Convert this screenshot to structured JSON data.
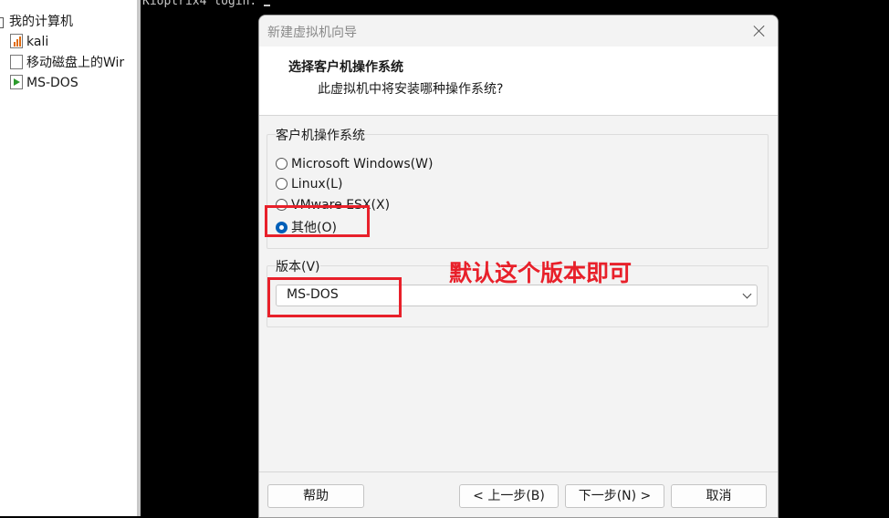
{
  "console": {
    "text": "Kioptrix4 login: "
  },
  "library": {
    "root": "我的计算机",
    "items": [
      {
        "label": "kali"
      },
      {
        "label": "移动磁盘上的Wir"
      },
      {
        "label": "MS-DOS"
      }
    ]
  },
  "dialog": {
    "title": "新建虚拟机向导",
    "header_title": "选择客户机操作系统",
    "header_subtitle": "此虚拟机中将安装哪种操作系统?",
    "os_group_label": "客户机操作系统",
    "os_options": [
      {
        "label": "Microsoft Windows(W)",
        "checked": false
      },
      {
        "label": "Linux(L)",
        "checked": false
      },
      {
        "label": "VMware ESX(X)",
        "checked": false
      },
      {
        "label": "其他(O)",
        "checked": true
      }
    ],
    "version_label": "版本(V)",
    "version_value": "MS-DOS",
    "buttons": {
      "help": "帮助",
      "back": "< 上一步(B)",
      "next": "下一步(N) >",
      "cancel": "取消"
    }
  },
  "annotation": {
    "text": "默认这个版本即可",
    "color": "#e8202a"
  }
}
